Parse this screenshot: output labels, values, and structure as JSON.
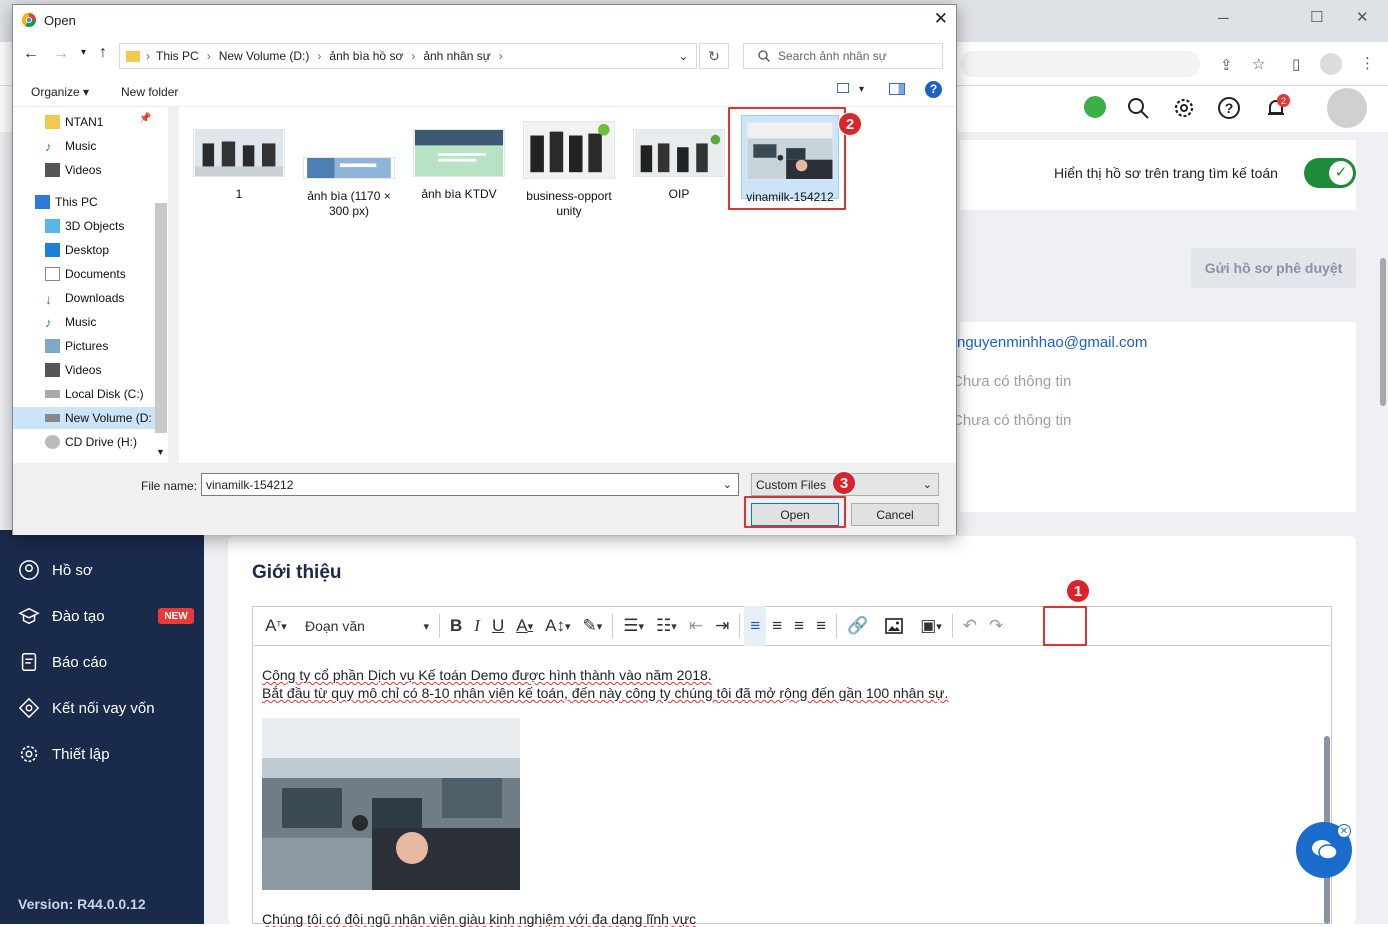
{
  "dialog": {
    "title": "Open",
    "breadcrumb": [
      "This PC",
      "New Volume (D:)",
      "ảnh bìa hồ sơ",
      "ảnh nhân sự"
    ],
    "search_placeholder": "Search ảnh nhân sự",
    "organize": "Organize",
    "new_folder": "New folder",
    "nav_items": [
      "NTAN1",
      "Music",
      "Videos",
      "This PC",
      "3D Objects",
      "Desktop",
      "Documents",
      "Downloads",
      "Music",
      "Pictures",
      "Videos",
      "Local Disk (C:)",
      "New Volume (D:",
      "CD Drive (H:)"
    ],
    "files": [
      {
        "name": "1"
      },
      {
        "name": "ảnh bìa (1170 × 300 px)"
      },
      {
        "name": "ảnh bìa KTDV"
      },
      {
        "name": "business-opport unity"
      },
      {
        "name": "OIP"
      },
      {
        "name": "vinamilk-154212"
      }
    ],
    "file_name_label": "File name:",
    "file_name_value": "vinamilk-154212",
    "file_type": "Custom Files",
    "open_button": "Open",
    "cancel_button": "Cancel"
  },
  "markers": {
    "m1": "1",
    "m2": "2",
    "m3": "3"
  },
  "app": {
    "notification_count": "2",
    "profile_toggle_label": "Hiển thị hồ sơ trên trang tìm kế toán",
    "submit_button": "Gửi hồ sơ phê duyệt",
    "email": "nguyenminhhao@gmail.com",
    "no_info_1": "Chưa có thông tin",
    "no_info_2": "Chưa có thông tin",
    "sidebar": [
      {
        "label": "Hồ sơ"
      },
      {
        "label": "Đào tạo",
        "badge": "NEW"
      },
      {
        "label": "Báo cáo"
      },
      {
        "label": "Kết nối vay vốn"
      },
      {
        "label": "Thiết lập"
      }
    ],
    "version": "Version: R44.0.0.12",
    "section_title": "Giới thiệu",
    "paragraph_style": "Đoạn văn",
    "editor_line1": "Công ty cổ phần Dịch vụ Kế toán Demo được hình thành vào năm 2018.",
    "editor_line2": "Bắt đầu từ quy mô chỉ có 8-10 nhân viên kế toán, đến này công ty chúng tôi đã mở rộng đến gần 100 nhân sự.",
    "editor_line3": "Chúng tôi có đội ngũ nhân viên giàu kinh nghiệm với đa dạng lĩnh vực"
  },
  "colors": {
    "sidebar_bg": "#1a2a4b",
    "toggle": "#1f8a3a",
    "marker": "#d9242a",
    "chat": "#1a6ccc"
  }
}
